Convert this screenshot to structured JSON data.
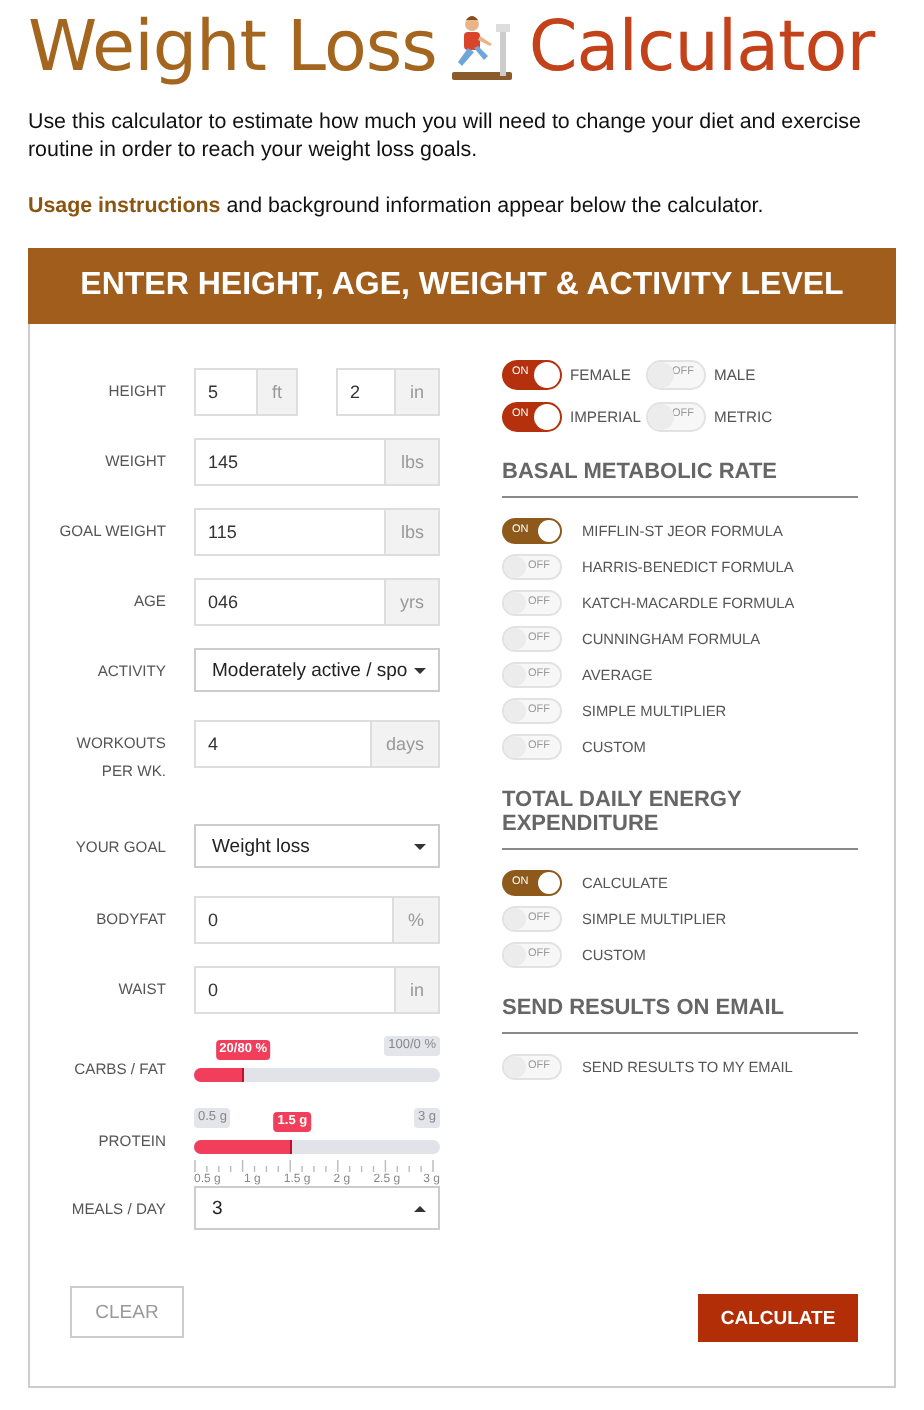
{
  "title": {
    "first": "Weight Loss",
    "second": "Calculator"
  },
  "intro": "Use this calculator to estimate how much you will need to change your diet and exercise routine in order to reach your weight loss goals.",
  "usage": {
    "link": "Usage instructions",
    "rest": " and background information appear below the calculator."
  },
  "panel_title": "ENTER HEIGHT, AGE, WEIGHT & ACTIVITY LEVEL",
  "inputs": [
    {
      "label": "HEIGHT",
      "kind": "input",
      "fields": [
        {
          "value": "5",
          "unit": "ft"
        },
        {
          "value": "2",
          "unit": "in"
        }
      ]
    },
    {
      "label": "WEIGHT",
      "kind": "input",
      "fields": [
        {
          "value": "145",
          "unit": "lbs"
        }
      ]
    },
    {
      "label": "GOAL WEIGHT",
      "kind": "input",
      "fields": [
        {
          "value": "115",
          "unit": "lbs"
        }
      ]
    },
    {
      "label": "AGE",
      "kind": "input",
      "fields": [
        {
          "value": "046",
          "unit": "yrs"
        }
      ]
    },
    {
      "label": "ACTIVITY",
      "kind": "select",
      "value": "Moderately active / spo",
      "caret_up": false
    },
    {
      "label": "WORKOUTS PER WK.",
      "kind": "input",
      "fields": [
        {
          "value": "4",
          "unit": "days"
        }
      ]
    },
    {
      "label": "YOUR GOAL",
      "kind": "select",
      "value": "Weight loss",
      "caret_up": false
    },
    {
      "label": "BODYFAT",
      "kind": "input",
      "fields": [
        {
          "value": "0",
          "unit": "%"
        }
      ]
    },
    {
      "label": "WAIST",
      "kind": "input",
      "fields": [
        {
          "value": "0",
          "unit": "in"
        }
      ]
    },
    {
      "label": "CARBS / FAT",
      "kind": "slider",
      "level": 0.2,
      "value": "20/80 %",
      "max": "100/0 %"
    },
    {
      "label": "PROTEIN",
      "kind": "slider",
      "level": 0.4,
      "value": "1.5 g",
      "min": "0.5 g",
      "max": "3 g",
      "ticks": [
        "0.5 g",
        "1 g",
        "1.5 g",
        "2 g",
        "2.5 g",
        "3 g"
      ]
    },
    {
      "label": "MEALS / DAY",
      "kind": "select",
      "value": "3",
      "caret_up": true
    }
  ],
  "unit_toggles": [
    {
      "label": "FEMALE",
      "on": true,
      "switch_text": "ON"
    },
    {
      "label": "MALE",
      "on": false,
      "switch_text": "OFF"
    },
    {
      "label": "IMPERIAL",
      "on": true,
      "switch_text": "ON"
    },
    {
      "label": "METRIC",
      "on": false,
      "switch_text": "OFF"
    }
  ],
  "sections": [
    {
      "title": "BASAL METABOLIC RATE",
      "toggles": [
        {
          "label": "MIFFLIN-ST JEOR FORMULA",
          "on": true,
          "switch_text": "ON"
        },
        {
          "label": "HARRIS-BENEDICT FORMULA",
          "on": false,
          "switch_text": "OFF"
        },
        {
          "label": "KATCH-MACARDLE FORMULA",
          "on": false,
          "switch_text": "OFF"
        },
        {
          "label": "CUNNINGHAM FORMULA",
          "on": false,
          "switch_text": "OFF"
        },
        {
          "label": "AVERAGE",
          "on": false,
          "switch_text": "OFF"
        },
        {
          "label": "SIMPLE MULTIPLIER",
          "on": false,
          "switch_text": "OFF"
        },
        {
          "label": "CUSTOM",
          "on": false,
          "switch_text": "OFF"
        }
      ]
    },
    {
      "title": "TOTAL DAILY ENERGY EXPENDITURE",
      "toggles": [
        {
          "label": "CALCULATE",
          "on": true,
          "switch_text": "ON"
        },
        {
          "label": "SIMPLE MULTIPLIER",
          "on": false,
          "switch_text": "OFF"
        },
        {
          "label": "CUSTOM",
          "on": false,
          "switch_text": "OFF"
        }
      ]
    },
    {
      "title": "SEND RESULTS ON EMAIL",
      "toggles": [
        {
          "label": "SEND RESULTS TO MY EMAIL",
          "on": false,
          "switch_text": "OFF"
        }
      ]
    }
  ],
  "buttons": {
    "clear": "CLEAR",
    "calculate": "CALCULATE"
  }
}
